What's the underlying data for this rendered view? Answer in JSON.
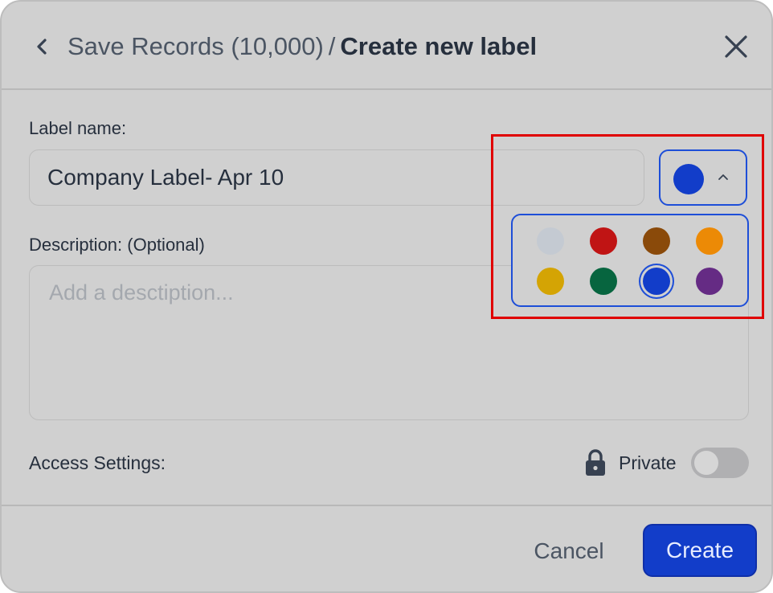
{
  "header": {
    "parent": "Save Records (10,000)",
    "separator": "/",
    "current": "Create new label"
  },
  "label_name": {
    "title": "Label name:",
    "value": "Company Label- Apr 10"
  },
  "color_picker": {
    "selected_color": "#123dc9",
    "swatches": [
      {
        "color": "#c4cad2"
      },
      {
        "color": "#c01414"
      },
      {
        "color": "#8a4a0a"
      },
      {
        "color": "#ec8a06"
      },
      {
        "color": "#d4a404"
      },
      {
        "color": "#07653f"
      },
      {
        "color": "#123dc9",
        "selected": true
      },
      {
        "color": "#652b84"
      }
    ]
  },
  "description": {
    "title": "Description: (Optional)",
    "placeholder": "Add a desctiption..."
  },
  "access": {
    "title": "Access Settings:",
    "private_label": "Private",
    "private_enabled": false
  },
  "footer": {
    "cancel_label": "Cancel",
    "create_label": "Create"
  },
  "colors": {
    "accent": "#1d4ed8",
    "highlight": "#e00000"
  }
}
